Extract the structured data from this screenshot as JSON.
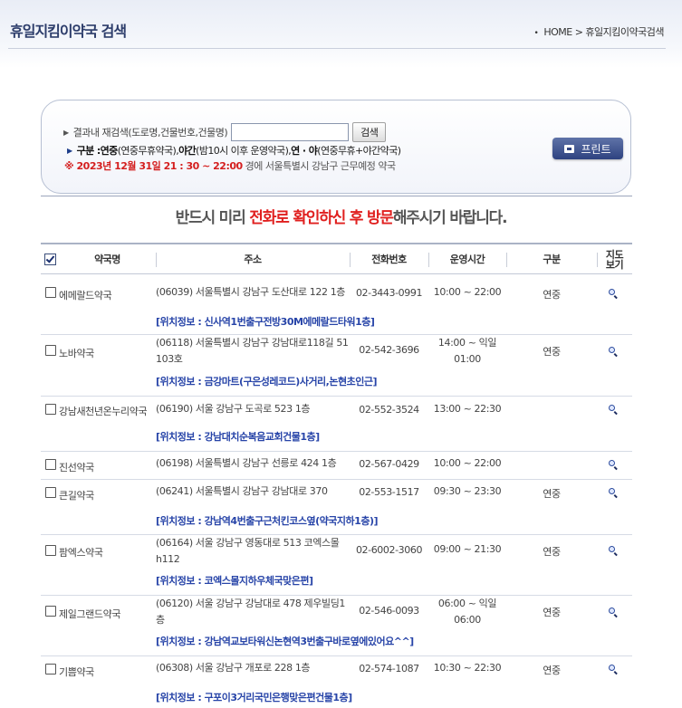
{
  "header": {
    "title": "휴일지킴이약국 검색",
    "breadcrumb_home": "HOME",
    "breadcrumb_sep": ">",
    "breadcrumb_current": "휴일지킴이약국검색"
  },
  "search": {
    "label": "결과내 재검색(도로명,건물번호,건물명)",
    "input_value": "",
    "button": "검색",
    "legend_kind_label": "구분 : ",
    "legend_yeonjung": "연중",
    "legend_yeonjung_desc": "(연중무휴약국), ",
    "legend_yagan": "야간",
    "legend_yagan_desc": "(밤10시 이후 운영약국), ",
    "legend_yeonya": "연 · 야",
    "legend_yeonya_desc": "(연중무휴+야간약국)",
    "date_line_red": "※ 2023년 12월 31일 21 : 30 ~ 22:00",
    "date_line_rest": " 경에  서울특별시  강남구   근무예정 약국",
    "print_button": "프린트"
  },
  "notice": {
    "pre": "반드시 미리 ",
    "highlight": "전화로 확인하신 후 방문",
    "post": "해주시기 바랍니다."
  },
  "table": {
    "headers": {
      "name": "약국명",
      "address": "주소",
      "tel": "전화번호",
      "hours": "운영시간",
      "type": "구분",
      "map_line1": "지도",
      "map_line2": "보기"
    },
    "rows": [
      {
        "name": "에메랄드약국",
        "address": "(06039) 서울특별시 강남구 도산대로 122 1층",
        "tel": "02-3443-0991",
        "hours": "10:00 ~ 22:00",
        "type": "연중",
        "location": "[위치정보 : 신사역1번출구전방30M에메랄드타워1층]"
      },
      {
        "name": "노바약국",
        "address": "(06118) 서울특별시 강남구 강남대로118길 51 103호",
        "tel": "02-542-3696",
        "hours": "14:00 ~ 익일 01:00",
        "type": "연중",
        "location": "[위치정보 : 금강마트(구은성레코드)사거리,논현초인근]"
      },
      {
        "name": "강남새천년온누리약국",
        "address": "(06190) 서울 강남구 도곡로 523 1층",
        "tel": "02-552-3524",
        "hours": "13:00 ~ 22:30",
        "type": "",
        "location": "[위치정보 : 강남대치순복음교회건물1층]"
      },
      {
        "name": "진선약국",
        "address": "(06198) 서울특별시 강남구 선릉로 424 1층",
        "tel": "02-567-0429",
        "hours": "10:00 ~ 22:00",
        "type": "",
        "location": ""
      },
      {
        "name": "큰길약국",
        "address": "(06241) 서울특별시 강남구 강남대로 370",
        "tel": "02-553-1517",
        "hours": "09:30 ~ 23:30",
        "type": "연중",
        "location": "[위치정보 : 강남역4번출구근처킨코스옆(약국지하1층)]"
      },
      {
        "name": "팜엑스약국",
        "address": "(06164) 서울 강남구 영동대로 513 코엑스몰 h112",
        "tel": "02-6002-3060",
        "hours": "09:00 ~ 21:30",
        "type": "연중",
        "location": "[위치정보 : 코엑스몰지하우체국맞은편]"
      },
      {
        "name": "제일그랜드약국",
        "address": "(06120) 서울 강남구 강남대로 478 제우빌딩1층",
        "tel": "02-546-0093",
        "hours": "06:00 ~ 익일 06:00",
        "type": "연중",
        "location": "[위치정보 : 강남역교보타워신논현역3번출구바로옆에있어요^^]"
      },
      {
        "name": "기쁨약국",
        "address": "(06308) 서울 강남구 개포로 228 1층",
        "tel": "02-574-1087",
        "hours": "10:30 ~ 22:30",
        "type": "연중",
        "location": "[위치정보 : 구포이3거리국민은행맞은편건물1층]"
      }
    ]
  }
}
